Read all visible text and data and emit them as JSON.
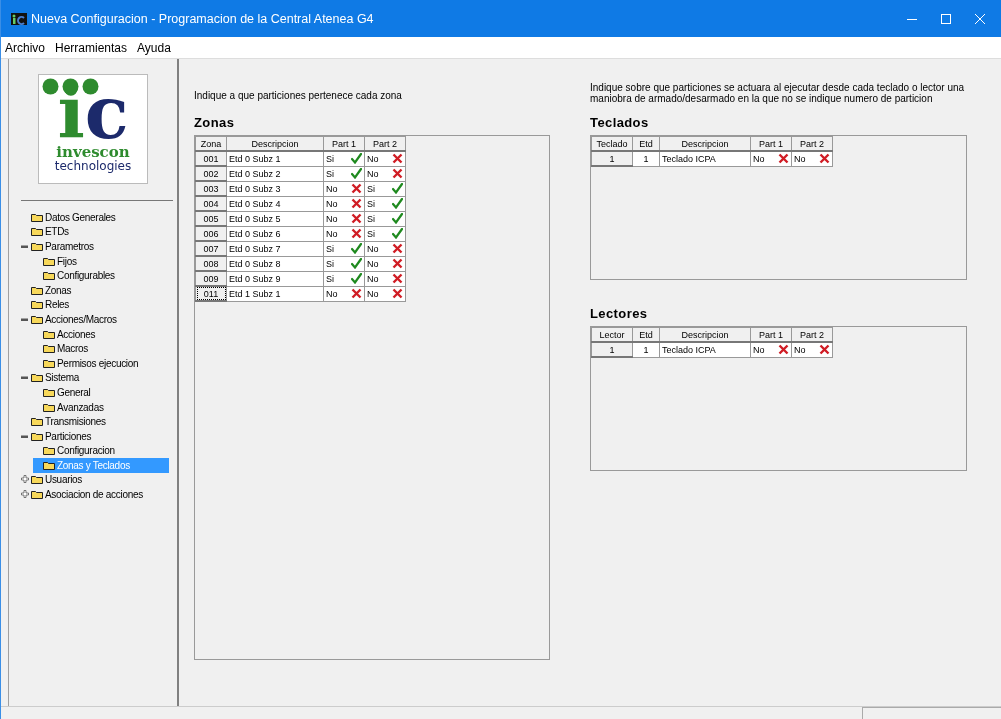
{
  "window": {
    "title": "Nueva Configuracion - Programacion de la Central Atenea G4"
  },
  "menu": [
    "Archivo",
    "Herramientas",
    "Ayuda"
  ],
  "logo": {
    "monogram": [
      "i",
      "c"
    ],
    "name": "invescon",
    "tagline": "technologies"
  },
  "tree": [
    {
      "label": "Datos Generales",
      "selected": false
    },
    {
      "label": "ETDs",
      "selected": false
    },
    {
      "label": "Parametros",
      "selected": false,
      "expanded": true,
      "children": [
        {
          "label": "Fijos",
          "selected": false
        },
        {
          "label": "Configurables",
          "selected": false
        }
      ]
    },
    {
      "label": "Zonas",
      "selected": false
    },
    {
      "label": "Reles",
      "selected": false
    },
    {
      "label": "Acciones/Macros",
      "selected": false,
      "expanded": true,
      "children": [
        {
          "label": "Acciones",
          "selected": false
        },
        {
          "label": "Macros",
          "selected": false
        },
        {
          "label": "Permisos ejecucion",
          "selected": false
        }
      ]
    },
    {
      "label": "Sistema",
      "selected": false,
      "expanded": true,
      "children": [
        {
          "label": "General",
          "selected": false
        },
        {
          "label": "Avanzadas",
          "selected": false
        }
      ]
    },
    {
      "label": "Transmisiones",
      "selected": false
    },
    {
      "label": "Particiones",
      "selected": false,
      "expanded": true,
      "children": [
        {
          "label": "Configuracion",
          "selected": false
        },
        {
          "label": "Zonas y Teclados",
          "selected": true
        }
      ]
    },
    {
      "label": "Usuarios",
      "selected": false,
      "expanded": false
    },
    {
      "label": "Asociacion de acciones",
      "selected": false,
      "expanded": false
    }
  ],
  "zonas": {
    "intro": "Indique a que particiones pertenece cada zona",
    "title": "Zonas",
    "columns": [
      "Zona",
      "Descripcion",
      "Part 1",
      "Part 2"
    ],
    "rows": [
      {
        "id": "001",
        "descripcion": "Etd 0 Subz 1",
        "part_1": {
          "text": "Si",
          "checked": true
        },
        "part_2": {
          "text": "No",
          "checked": false
        },
        "focused": false
      },
      {
        "id": "002",
        "descripcion": "Etd 0 Subz 2",
        "part_1": {
          "text": "Si",
          "checked": true
        },
        "part_2": {
          "text": "No",
          "checked": false
        },
        "focused": false
      },
      {
        "id": "003",
        "descripcion": "Etd 0 Subz 3",
        "part_1": {
          "text": "No",
          "checked": false
        },
        "part_2": {
          "text": "Si",
          "checked": true
        },
        "focused": false
      },
      {
        "id": "004",
        "descripcion": "Etd 0 Subz 4",
        "part_1": {
          "text": "No",
          "checked": false
        },
        "part_2": {
          "text": "Si",
          "checked": true
        },
        "focused": false
      },
      {
        "id": "005",
        "descripcion": "Etd 0 Subz 5",
        "part_1": {
          "text": "No",
          "checked": false
        },
        "part_2": {
          "text": "Si",
          "checked": true
        },
        "focused": false
      },
      {
        "id": "006",
        "descripcion": "Etd 0 Subz 6",
        "part_1": {
          "text": "No",
          "checked": false
        },
        "part_2": {
          "text": "Si",
          "checked": true
        },
        "focused": false
      },
      {
        "id": "007",
        "descripcion": "Etd 0 Subz 7",
        "part_1": {
          "text": "Si",
          "checked": true
        },
        "part_2": {
          "text": "No",
          "checked": false
        },
        "focused": false
      },
      {
        "id": "008",
        "descripcion": "Etd 0 Subz 8",
        "part_1": {
          "text": "Si",
          "checked": true
        },
        "part_2": {
          "text": "No",
          "checked": false
        },
        "focused": false
      },
      {
        "id": "009",
        "descripcion": "Etd 0 Subz 9",
        "part_1": {
          "text": "Si",
          "checked": true
        },
        "part_2": {
          "text": "No",
          "checked": false
        },
        "focused": false
      },
      {
        "id": "011",
        "descripcion": "Etd 1 Subz 1",
        "part_1": {
          "text": "No",
          "checked": false
        },
        "part_2": {
          "text": "No",
          "checked": false
        },
        "focused": true
      }
    ]
  },
  "right_intro": "Indique sobre que particiones se actuara al ejecutar desde cada teclado o lector una maniobra de armado/desarmado en la que no se indique numero de particion",
  "teclados": {
    "title": "Teclados",
    "columns": [
      "Teclado",
      "Etd",
      "Descripcion",
      "Part 1",
      "Part 2"
    ],
    "rows": [
      {
        "id": "1",
        "etd": "1",
        "descripcion": "Teclado ICPA",
        "part_1": {
          "text": "No",
          "checked": false
        },
        "part_2": {
          "text": "No",
          "checked": false
        }
      }
    ]
  },
  "lectores": {
    "title": "Lectores",
    "columns": [
      "Lector",
      "Etd",
      "Descripcion",
      "Part 1",
      "Part 2"
    ],
    "rows": [
      {
        "id": "1",
        "etd": "1",
        "descripcion": "Teclado ICPA",
        "part_1": {
          "text": "No",
          "checked": false
        },
        "part_2": {
          "text": "No",
          "checked": false
        }
      }
    ]
  }
}
